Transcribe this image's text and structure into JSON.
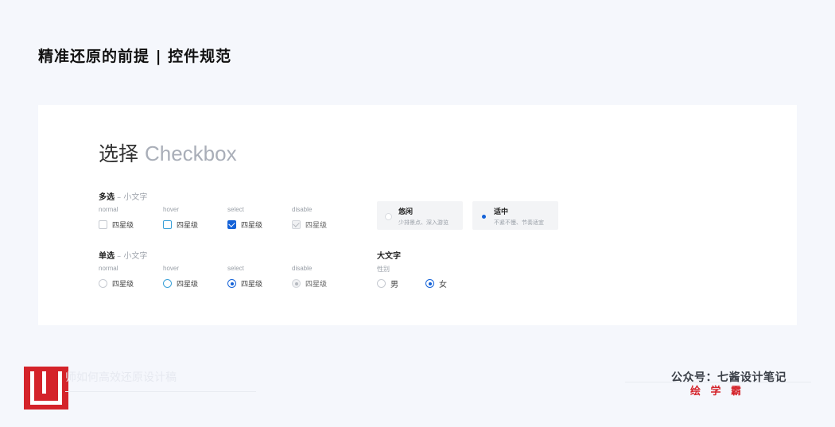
{
  "page": {
    "title": "精准还原的前提 | 控件规范"
  },
  "heading": {
    "cn": "选择",
    "en": "Checkbox"
  },
  "multi": {
    "title": "多选",
    "subtitle": " – 小文字",
    "states": [
      "normal",
      "hover",
      "select",
      "disable"
    ],
    "option_label": "四星级"
  },
  "tiles": [
    {
      "title": "悠闲",
      "desc": "少排景点、深入游览",
      "selected": false
    },
    {
      "title": "适中",
      "desc": "不紧不慢、节奏适宜",
      "selected": true
    }
  ],
  "single": {
    "title": "单选",
    "subtitle": " – 小文字",
    "states": [
      "normal",
      "hover",
      "select",
      "disable"
    ],
    "option_label": "四星级"
  },
  "large": {
    "title": "大文字",
    "field_label": "性别",
    "options": [
      {
        "label": "男",
        "selected": false
      },
      {
        "label": "女",
        "selected": true
      }
    ]
  },
  "footer": {
    "left_text": "师如何高效还原设计稿",
    "wechat": "公众号：七酱设计笔记",
    "brand": "绘 学 霸"
  },
  "colors": {
    "accent": "#1462d8",
    "hover": "#3aa0d8",
    "brand": "#d4232a"
  }
}
